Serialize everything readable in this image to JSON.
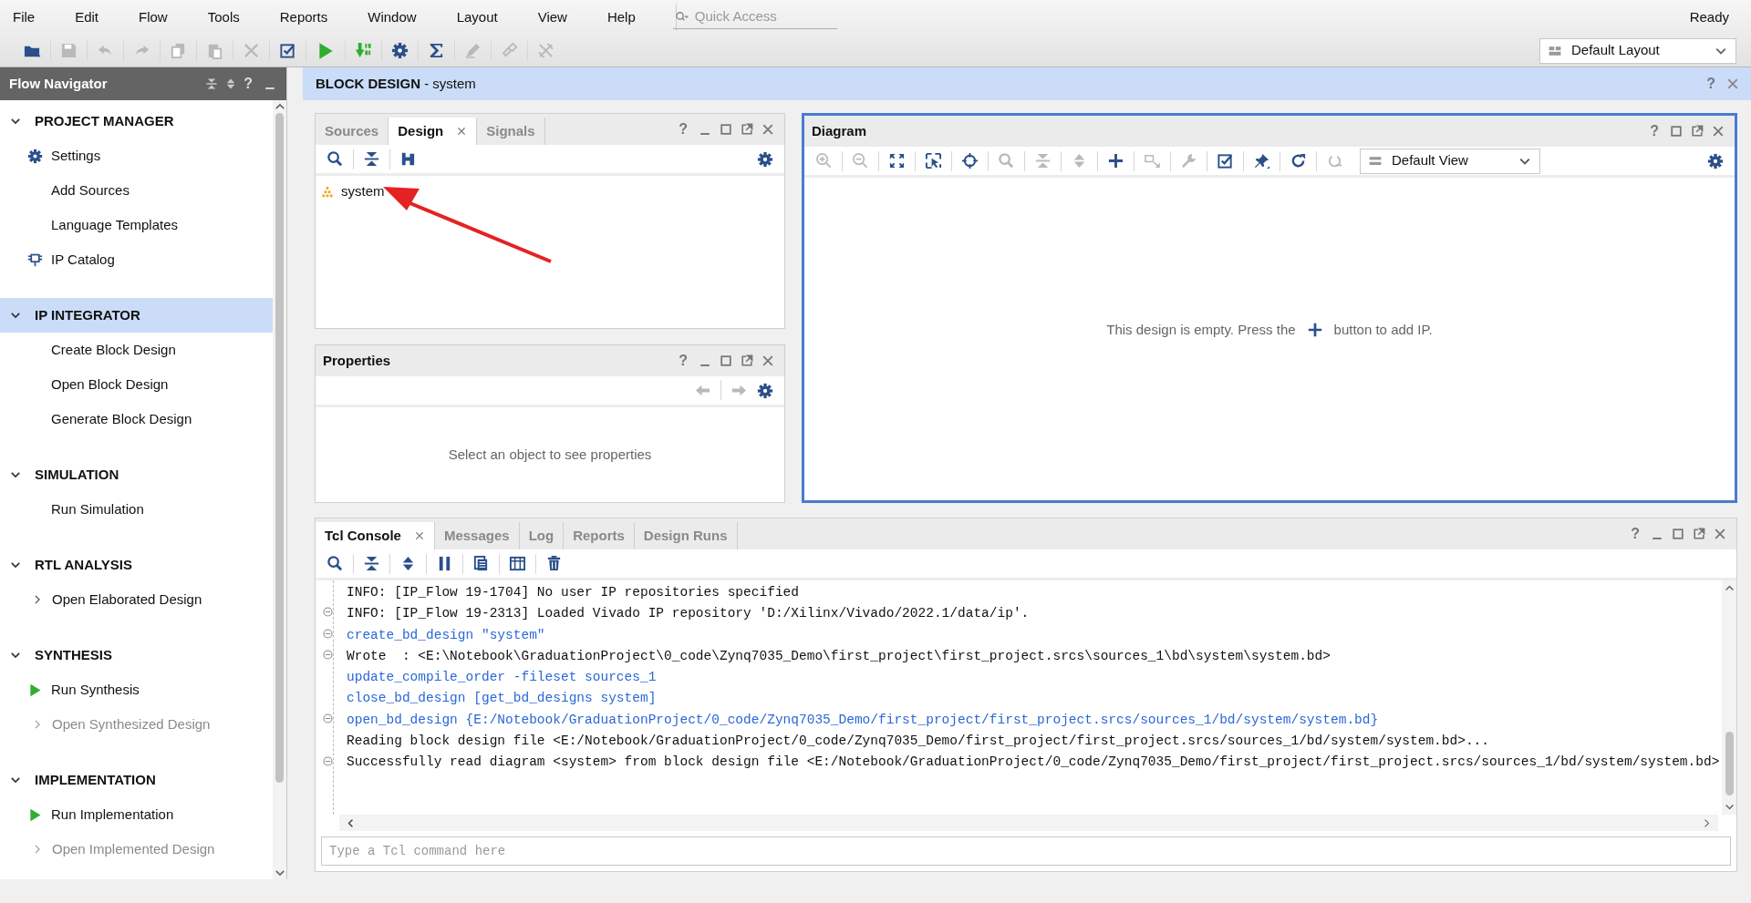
{
  "menu": [
    "File",
    "Edit",
    "Flow",
    "Tools",
    "Reports",
    "Window",
    "Layout",
    "View",
    "Help"
  ],
  "quick_access": {
    "placeholder": "Quick Access"
  },
  "status": "Ready",
  "main_toolbar": [
    {
      "kind": "folder",
      "disabled": false
    },
    {
      "kind": "save",
      "disabled": true
    },
    {
      "kind": "undo",
      "disabled": true
    },
    {
      "kind": "redo",
      "disabled": true
    },
    {
      "kind": "copy",
      "disabled": true
    },
    {
      "kind": "paste",
      "disabled": true
    },
    {
      "kind": "delete",
      "disabled": true
    },
    {
      "kind": "check",
      "disabled": false
    },
    {
      "kind": "run",
      "disabled": false
    },
    {
      "kind": "download",
      "disabled": false
    },
    {
      "kind": "gear",
      "disabled": false
    },
    {
      "kind": "sigma",
      "disabled": false
    },
    {
      "kind": "pencil",
      "disabled": true
    },
    {
      "kind": "link",
      "disabled": true
    },
    {
      "kind": "cross",
      "disabled": true
    }
  ],
  "layout_select": {
    "value": "Default Layout"
  },
  "flow_navigator": {
    "title": "Flow Navigator",
    "help": "?",
    "sections": [
      {
        "title": "PROJECT MANAGER",
        "expanded": true,
        "selected": false,
        "items": [
          {
            "label": "Settings",
            "kind": "gear",
            "disabled": false
          },
          {
            "label": "Add Sources",
            "kind": "plain",
            "disabled": false
          },
          {
            "label": "Language Templates",
            "kind": "plain",
            "disabled": false
          },
          {
            "label": "IP Catalog",
            "kind": "chip",
            "disabled": false
          }
        ]
      },
      {
        "title": "IP INTEGRATOR",
        "expanded": true,
        "selected": true,
        "items": [
          {
            "label": "Create Block Design",
            "kind": "plain",
            "disabled": false
          },
          {
            "label": "Open Block Design",
            "kind": "plain",
            "disabled": false
          },
          {
            "label": "Generate Block Design",
            "kind": "plain",
            "disabled": false
          }
        ]
      },
      {
        "title": "SIMULATION",
        "expanded": true,
        "selected": false,
        "items": [
          {
            "label": "Run Simulation",
            "kind": "plain",
            "disabled": false
          }
        ]
      },
      {
        "title": "RTL ANALYSIS",
        "expanded": true,
        "selected": false,
        "items": [
          {
            "label": "Open Elaborated Design",
            "kind": "expander",
            "disabled": false
          }
        ]
      },
      {
        "title": "SYNTHESIS",
        "expanded": true,
        "selected": false,
        "items": [
          {
            "label": "Run Synthesis",
            "kind": "run",
            "disabled": false
          },
          {
            "label": "Open Synthesized Design",
            "kind": "expander",
            "disabled": true
          }
        ]
      },
      {
        "title": "IMPLEMENTATION",
        "expanded": true,
        "selected": false,
        "items": [
          {
            "label": "Run Implementation",
            "kind": "run",
            "disabled": false
          },
          {
            "label": "Open Implemented Design",
            "kind": "expander",
            "disabled": true
          }
        ]
      }
    ]
  },
  "block_design": {
    "title": "**BLOCK DESIGN** - system",
    "help": "?"
  },
  "design_panel": {
    "tabs": [
      {
        "label": "Sources",
        "selected": false
      },
      {
        "label": "Design",
        "selected": true
      },
      {
        "label": "Signals",
        "selected": false
      }
    ],
    "help": "?",
    "toolbar": [
      {
        "kind": "search",
        "disabled": false
      },
      {
        "kind": "collapse",
        "disabled": false
      },
      {
        "kind": "hierarchy",
        "disabled": false
      }
    ],
    "tree": [
      {
        "label": "system"
      }
    ]
  },
  "properties_panel": {
    "title": "Properties",
    "help": "?",
    "toolbar": [
      {
        "kind": "back",
        "disabled": true
      },
      {
        "kind": "forward",
        "disabled": true
      }
    ],
    "empty_message": "Select an object to see properties"
  },
  "diagram_panel": {
    "title": "Diagram",
    "help": "?",
    "focused": true,
    "toolbar": [
      {
        "kind": "zoom-in",
        "disabled": true
      },
      {
        "kind": "zoom-out",
        "disabled": true
      },
      {
        "kind": "fit",
        "disabled": false
      },
      {
        "kind": "selection",
        "disabled": false
      },
      {
        "kind": "crosshair",
        "disabled": false
      },
      {
        "kind": "search",
        "disabled": true
      },
      {
        "kind": "collapse",
        "disabled": true
      },
      {
        "kind": "expand",
        "disabled": true
      },
      {
        "kind": "plus",
        "disabled": false
      },
      {
        "kind": "connector",
        "disabled": true
      },
      {
        "kind": "wrench",
        "disabled": true
      },
      {
        "kind": "check",
        "disabled": false
      },
      {
        "kind": "pin",
        "disabled": false
      },
      {
        "kind": "refresh",
        "disabled": false
      },
      {
        "kind": "reset",
        "disabled": true
      }
    ],
    "view_select": {
      "value": "Default View"
    },
    "empty_message": {
      "before": "This design is empty. Press the",
      "after": "button to add IP."
    }
  },
  "console": {
    "tabs": [
      {
        "label": "Tcl Console",
        "selected": true
      },
      {
        "label": "Messages",
        "selected": false
      },
      {
        "label": "Log",
        "selected": false
      },
      {
        "label": "Reports",
        "selected": false
      },
      {
        "label": "Design Runs",
        "selected": false
      }
    ],
    "help": "?",
    "toolbar": [
      {
        "kind": "search",
        "disabled": false
      },
      {
        "kind": "collapse",
        "disabled": false
      },
      {
        "kind": "expand",
        "disabled": false
      },
      {
        "kind": "pause",
        "disabled": false
      },
      {
        "kind": "document",
        "disabled": false
      },
      {
        "kind": "columns",
        "disabled": false
      },
      {
        "kind": "trash",
        "disabled": false
      }
    ],
    "lines": [
      {
        "text": "INFO: [IP_Flow 19-1704] No user IP repositories specified",
        "kind": "output",
        "fold": false
      },
      {
        "text": "INFO: [IP_Flow 19-2313] Loaded Vivado IP repository 'D:/Xilinx/Vivado/2022.1/data/ip'.",
        "kind": "output",
        "fold": true
      },
      {
        "text": "create_bd_design \"system\"",
        "kind": "command",
        "fold": true
      },
      {
        "text": "Wrote  : <E:\\Notebook\\GraduationProject\\0_code\\Zynq7035_Demo\\first_project\\first_project.srcs\\sources_1\\bd\\system\\system.bd>",
        "kind": "output",
        "fold": true
      },
      {
        "text": "update_compile_order -fileset sources_1",
        "kind": "command",
        "fold": false
      },
      {
        "text": "close_bd_design [get_bd_designs system]",
        "kind": "command",
        "fold": false
      },
      {
        "text": "open_bd_design {E:/Notebook/GraduationProject/0_code/Zynq7035_Demo/first_project/first_project.srcs/sources_1/bd/system/system.bd}",
        "kind": "command",
        "fold": true
      },
      {
        "text": "Reading block design file <E:/Notebook/GraduationProject/0_code/Zynq7035_Demo/first_project/first_project.srcs/sources_1/bd/system/system.bd>...",
        "kind": "output",
        "fold": false
      },
      {
        "text": "Successfully read diagram <system> from block design file <E:/Notebook/GraduationProject/0_code/Zynq7035_Demo/first_project/first_project.srcs/sources_1/bd/system/system.bd>",
        "kind": "output",
        "fold": true
      }
    ],
    "input": {
      "placeholder": "Type a Tcl command here"
    }
  }
}
